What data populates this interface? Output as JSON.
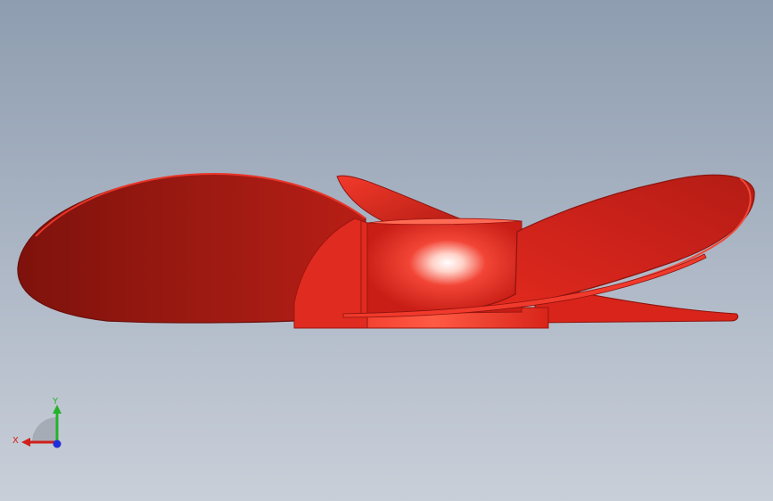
{
  "viewport": {
    "background_top": "#8e9db0",
    "background_bottom": "#c9cfd9"
  },
  "model": {
    "name": "propeller",
    "color": "#d8241a",
    "dark_color": "#7e120c",
    "highlight_color": "#ffffff"
  },
  "triad": {
    "x_label": "X",
    "y_label": "Y",
    "x_color": "#d0201a",
    "y_color": "#22b32a",
    "z_color": "#1e2ed8"
  }
}
